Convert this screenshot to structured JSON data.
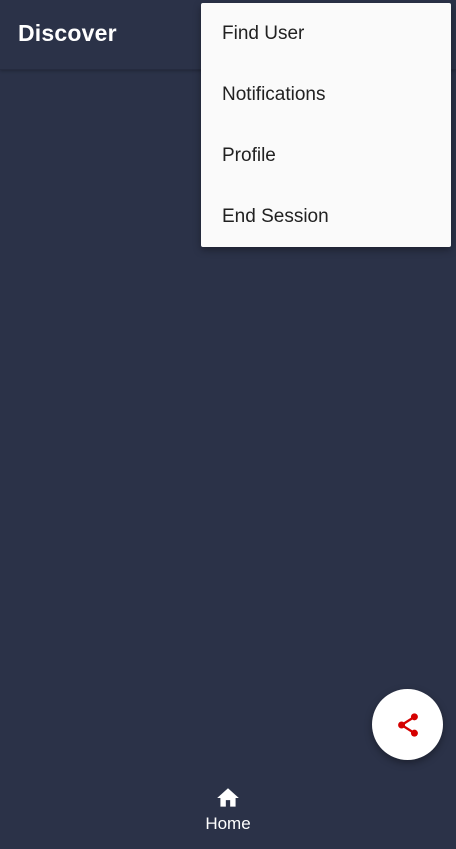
{
  "app_bar": {
    "title": "Discover"
  },
  "overflow_menu": {
    "items": [
      {
        "label": "Find User"
      },
      {
        "label": "Notifications"
      },
      {
        "label": "Profile"
      },
      {
        "label": "End Session"
      }
    ]
  },
  "fab": {
    "icon": "share-icon",
    "icon_color": "#d50000"
  },
  "bottom_nav": {
    "items": [
      {
        "label": "Home",
        "icon": "home-icon"
      }
    ]
  },
  "colors": {
    "background": "#2b3248",
    "menu_background": "#fafafa",
    "accent": "#d50000"
  }
}
